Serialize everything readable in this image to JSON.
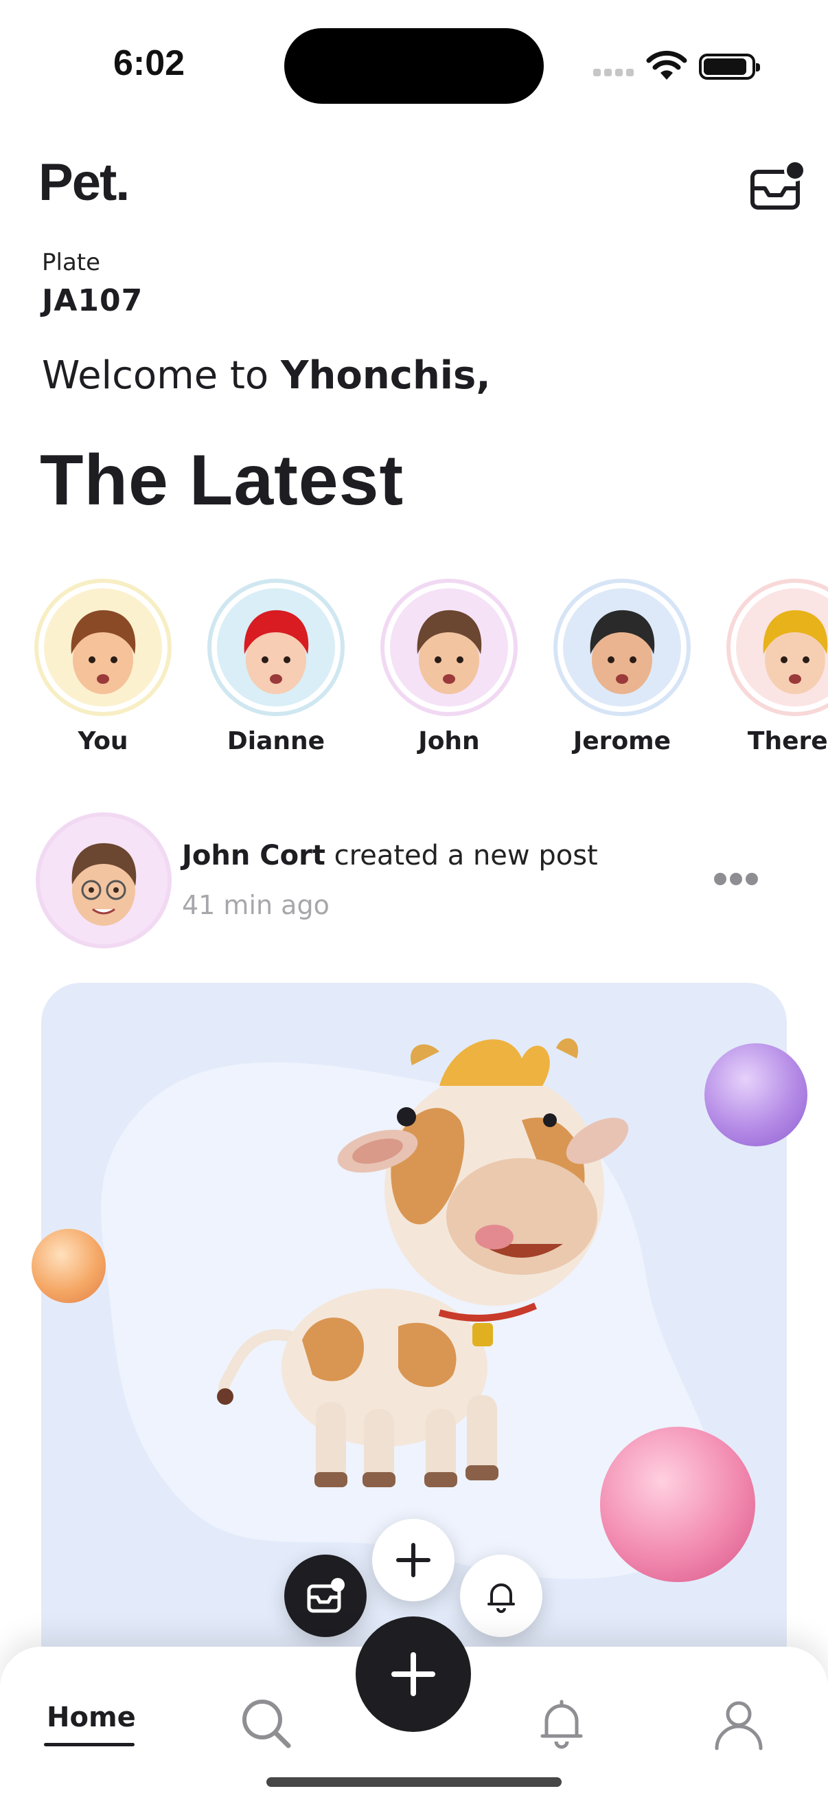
{
  "status_bar": {
    "time": "6:02"
  },
  "header": {
    "logo": "Pet.",
    "plate_label": "Plate",
    "plate_value": "JA107",
    "welcome_prefix": "Welcome to ",
    "welcome_name": "Yhonchis,",
    "section_title": "The Latest"
  },
  "stories": [
    {
      "name": "You",
      "ring": "#f7eec4",
      "bg": "#fbf1cf",
      "hair": "#8b4a26",
      "skin": "#f5c29a"
    },
    {
      "name": "Dianne",
      "ring": "#cfe7f0",
      "bg": "#d9eef6",
      "hair": "#d81c22",
      "skin": "#f7cdb3"
    },
    {
      "name": "John",
      "ring": "#f1d9f3",
      "bg": "#f5e2f7",
      "hair": "#6b4630",
      "skin": "#f2c4a0"
    },
    {
      "name": "Jerome",
      "ring": "#d6e4f6",
      "bg": "#dde9f8",
      "hair": "#2a2a2a",
      "skin": "#e9b48f"
    },
    {
      "name": "Theres",
      "ring": "#f8d8d8",
      "bg": "#fbe4e4",
      "hair": "#e8b21a",
      "skin": "#f6cfb3"
    }
  ],
  "post": {
    "author": "John Cort",
    "action": " created a new post",
    "time": "41 min ago"
  },
  "nav": {
    "home_label": "Home"
  },
  "colors": {
    "primary": "#1d1d22",
    "card_bg": "#e3ebfa",
    "muted": "#a7a7ab"
  }
}
